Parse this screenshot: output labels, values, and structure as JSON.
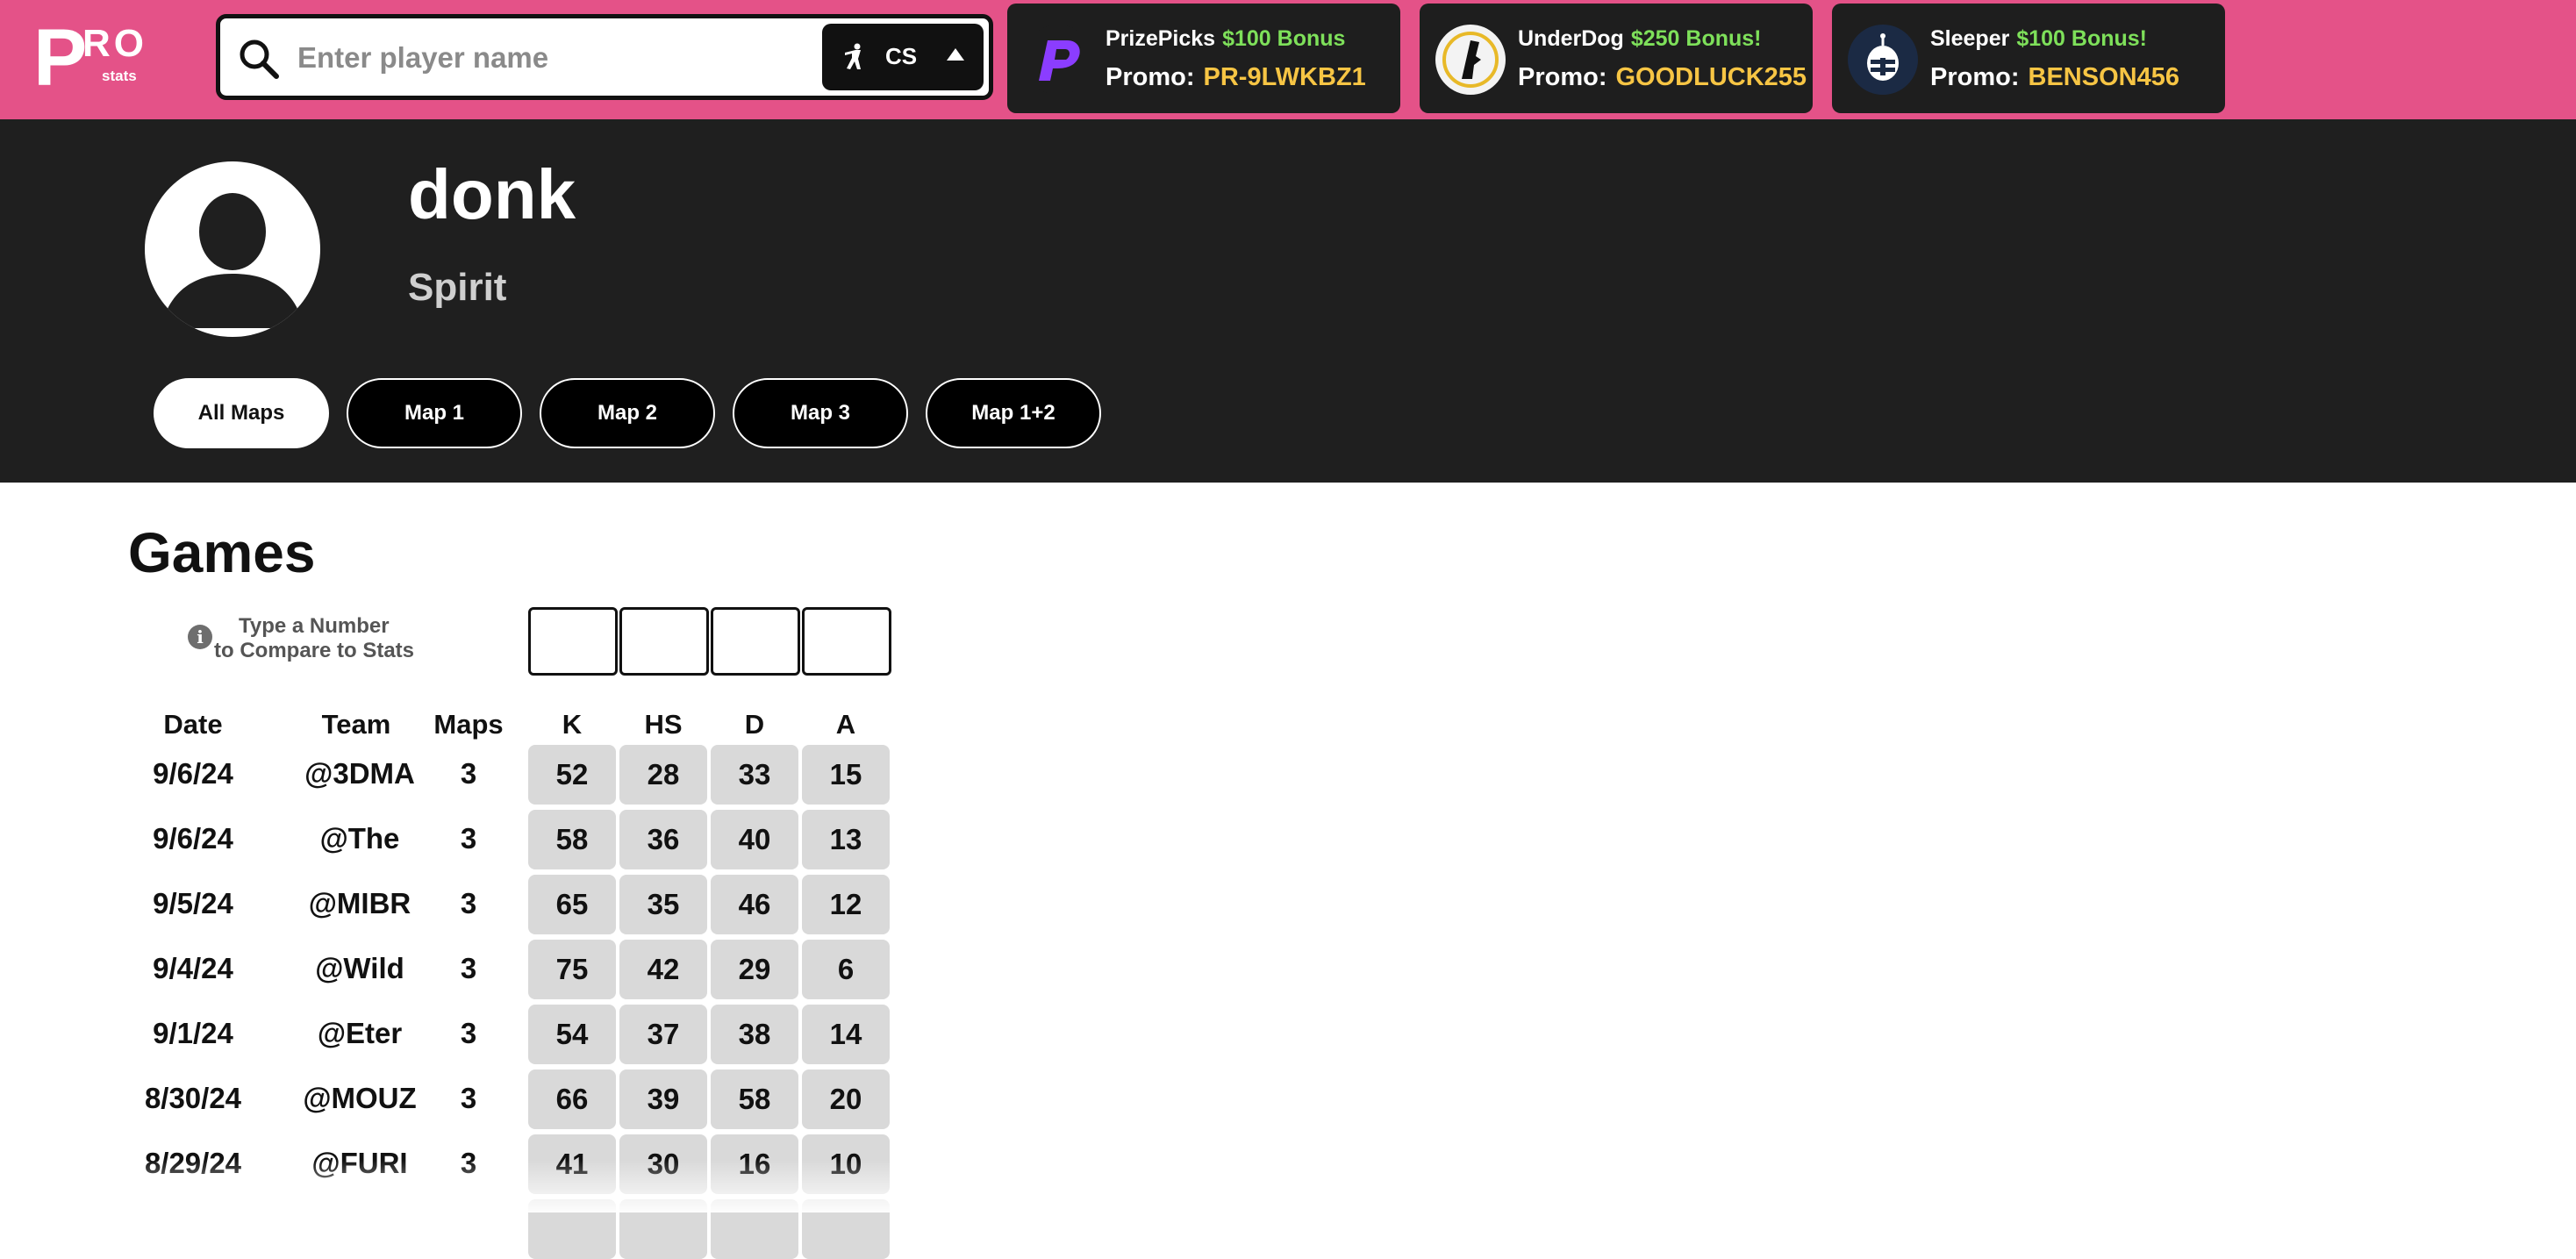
{
  "logo": {
    "main_p": "P",
    "main_ro": "RO",
    "sub": "stats"
  },
  "search": {
    "placeholder": "Enter player name",
    "game_label": "CS"
  },
  "promos": [
    {
      "brand": "PrizePicks",
      "bonus": "$100 Bonus",
      "promo_label": "Promo:",
      "code": "PR-9LWKBZ1"
    },
    {
      "brand": "UnderDog",
      "bonus": "$250 Bonus!",
      "promo_label": "Promo:",
      "code": "GOODLUCK255"
    },
    {
      "brand": "Sleeper",
      "bonus": "$100 Bonus!",
      "promo_label": "Promo:",
      "code": "BENSON456"
    }
  ],
  "player": {
    "name": "donk",
    "team": "Spirit"
  },
  "map_tabs": [
    "All Maps",
    "Map 1",
    "Map 2",
    "Map 3",
    "Map 1+2"
  ],
  "active_tab": "All Maps",
  "games": {
    "title": "Games",
    "hint_line1": "Type a Number",
    "hint_line2": "to Compare to Stats",
    "columns": [
      "Date",
      "Team",
      "Maps",
      "K",
      "HS",
      "D",
      "A"
    ],
    "rows": [
      [
        "9/6/24",
        "@3DMA",
        "3",
        "52",
        "28",
        "33",
        "15"
      ],
      [
        "9/6/24",
        "@The",
        "3",
        "58",
        "36",
        "40",
        "13"
      ],
      [
        "9/5/24",
        "@MIBR",
        "3",
        "65",
        "35",
        "46",
        "12"
      ],
      [
        "9/4/24",
        "@Wild",
        "3",
        "75",
        "42",
        "29",
        "6"
      ],
      [
        "9/1/24",
        "@Eter",
        "3",
        "54",
        "37",
        "38",
        "14"
      ],
      [
        "8/30/24",
        "@MOUZ",
        "3",
        "66",
        "39",
        "58",
        "20"
      ],
      [
        "8/29/24",
        "@FURI",
        "3",
        "41",
        "30",
        "16",
        "10"
      ]
    ]
  },
  "colors": {
    "topbar": "#e45288",
    "header_bg": "#1f1f1f",
    "promo_bonus": "#7ee05a",
    "promo_code": "#f7c544",
    "stat_cell": "#d9d9d9"
  }
}
